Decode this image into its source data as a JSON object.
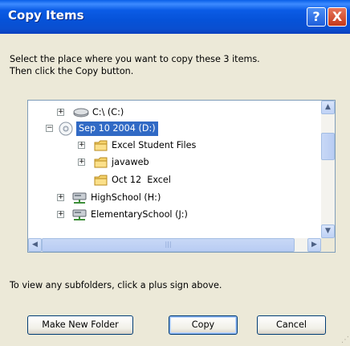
{
  "window": {
    "title": "Copy Items",
    "help_glyph": "?",
    "close_glyph": "X"
  },
  "instructions": {
    "line1": "Select the place where you want to copy these 3 items.",
    "line2": "Then click the Copy button."
  },
  "tree": {
    "items": [
      {
        "label": "C:\\ (C:)",
        "expander": "+",
        "icon": "hard-drive-icon"
      },
      {
        "label": "Sep 10 2004 (D:)",
        "expander": "−",
        "icon": "cd-drive-icon",
        "selected": true
      },
      {
        "label": "Excel Student Files",
        "expander": "+",
        "icon": "folder-icon"
      },
      {
        "label": "javaweb",
        "expander": "+",
        "icon": "folder-icon"
      },
      {
        "label": "Oct 12  Excel",
        "expander": "",
        "icon": "folder-icon"
      },
      {
        "label": "HighSchool (H:)",
        "expander": "+",
        "icon": "network-drive-icon"
      },
      {
        "label": "ElementarySchool (J:)",
        "expander": "+",
        "icon": "network-drive-icon"
      }
    ]
  },
  "scrollbars": {
    "up_glyph": "▲",
    "down_glyph": "▼",
    "left_glyph": "◀",
    "right_glyph": "▶",
    "grip_glyph": "|||"
  },
  "hint": "To view any subfolders, click a plus sign above.",
  "buttons": {
    "make_new_folder": "Make New Folder",
    "copy": "Copy",
    "cancel": "Cancel"
  },
  "colors": {
    "titlebar": "#0A4FD0",
    "selection": "#316AC5",
    "dialog_bg": "#ECE9D8"
  }
}
